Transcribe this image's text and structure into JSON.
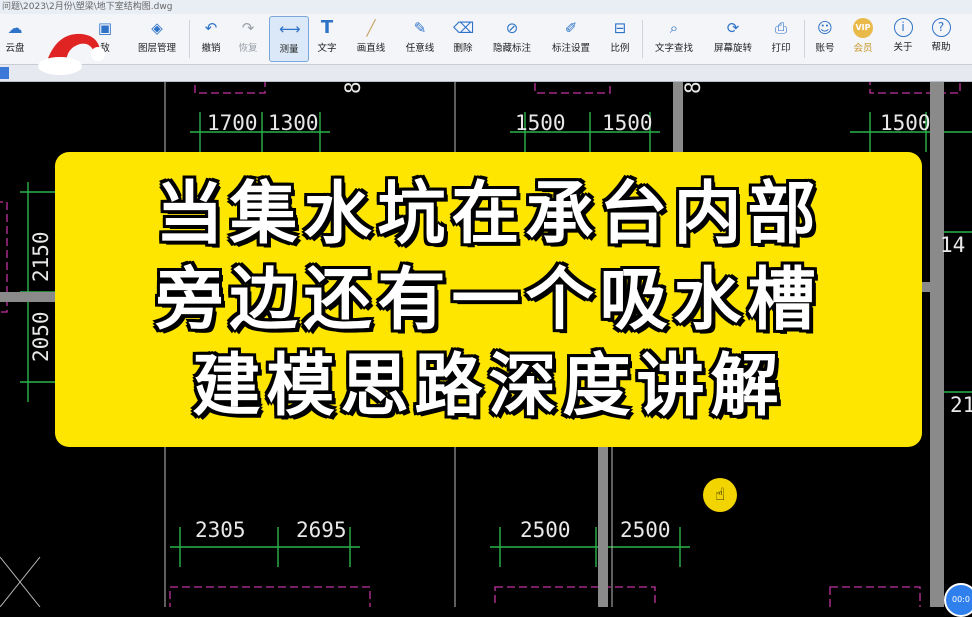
{
  "window": {
    "title": "问题\\2023\\2月份\\塑梁\\地下室结构图.dwg"
  },
  "toolbar": {
    "tools": [
      {
        "label": "云盘",
        "icon": "cloud-icon"
      },
      {
        "label": "图层管理",
        "icon": "layers-icon"
      },
      {
        "label": "撤销",
        "icon": "undo-icon"
      },
      {
        "label": "恢复",
        "icon": "redo-icon"
      },
      {
        "label": "测量",
        "icon": "measure-icon"
      },
      {
        "label": "文字",
        "icon": "text-icon"
      },
      {
        "label": "画直线",
        "icon": "line-icon"
      },
      {
        "label": "任意线",
        "icon": "pencil-icon"
      },
      {
        "label": "删除",
        "icon": "eraser-icon"
      },
      {
        "label": "隐藏标注",
        "icon": "eye-hide-icon"
      },
      {
        "label": "标注设置",
        "icon": "annotation-settings-icon"
      },
      {
        "label": "比例",
        "icon": "scale-icon"
      },
      {
        "label": "文字查找",
        "icon": "text-search-icon"
      },
      {
        "label": "屏幕旋转",
        "icon": "rotate-screen-icon"
      },
      {
        "label": "打印",
        "icon": "print-icon"
      },
      {
        "label": "账号",
        "icon": "user-icon"
      },
      {
        "label": "会员",
        "icon": "vip-icon"
      },
      {
        "label": "关于",
        "icon": "info-icon"
      },
      {
        "label": "帮助",
        "icon": "help-icon"
      }
    ],
    "partial_label": "敌"
  },
  "drawing": {
    "dims_top": [
      "1700",
      "1300",
      "1500",
      "1500",
      "1500"
    ],
    "dims_left": [
      "2150",
      "2050"
    ],
    "dims_bottom": [
      "2305",
      "2695",
      "2500",
      "2500"
    ],
    "marks": [
      "80",
      "80",
      "14",
      "21"
    ]
  },
  "banner": {
    "lines": [
      "当集水坑在承台内部",
      "旁边还有一个吸水槽",
      "建模思路深度讲解"
    ],
    "background": "#ffe600"
  },
  "corner_button": {
    "label": "00:0"
  }
}
